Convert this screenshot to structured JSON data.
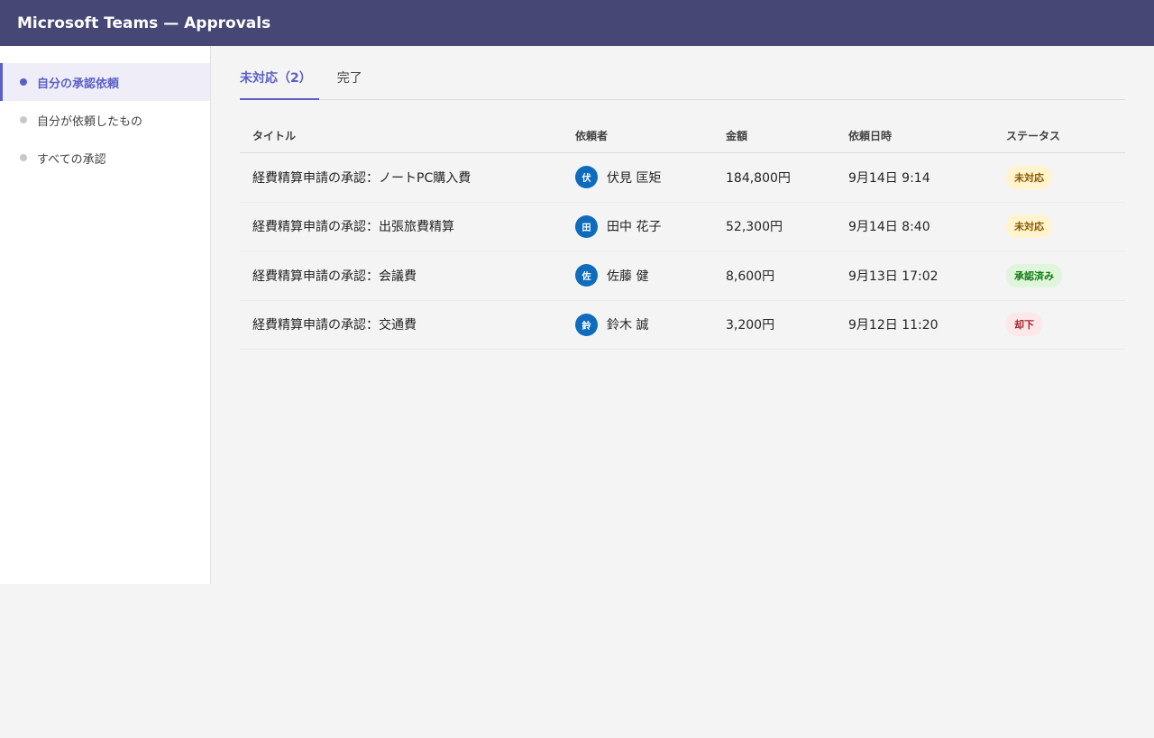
{
  "header": {
    "title": "Microsoft Teams — Approvals"
  },
  "sidebar": {
    "items": [
      {
        "label": "自分の承認依頼",
        "active": true
      },
      {
        "label": "自分が依頼したもの",
        "active": false
      },
      {
        "label": "すべての承認",
        "active": false
      }
    ]
  },
  "tabs": [
    {
      "label": "未対応（2）",
      "active": true
    },
    {
      "label": "完了",
      "active": false
    }
  ],
  "table": {
    "columns": [
      "タイトル",
      "依頼者",
      "金額",
      "依頼日時",
      "ステータス"
    ],
    "rows": [
      {
        "title": "経費精算申請の承認：ノートPC購入費",
        "avatar": "伏",
        "requester": "伏見 匡矩",
        "amount": "184,800円",
        "date": "9月14日 9:14",
        "status": "未対応",
        "status_type": "pending"
      },
      {
        "title": "経費精算申請の承認：出張旅費精算",
        "avatar": "田",
        "requester": "田中 花子",
        "amount": "52,300円",
        "date": "9月14日 8:40",
        "status": "未対応",
        "status_type": "pending"
      },
      {
        "title": "経費精算申請の承認：会議費",
        "avatar": "佐",
        "requester": "佐藤 健",
        "amount": "8,600円",
        "date": "9月13日 17:02",
        "status": "承認済み",
        "status_type": "approved"
      },
      {
        "title": "経費精算申請の承認：交通費",
        "avatar": "鈴",
        "requester": "鈴木 誠",
        "amount": "3,200円",
        "date": "9月12日 11:20",
        "status": "却下",
        "status_type": "rejected"
      }
    ]
  },
  "colors": {
    "header_bg": "#464775",
    "accent": "#5b5fc7",
    "avatar_bg": "#0f6cbd"
  }
}
